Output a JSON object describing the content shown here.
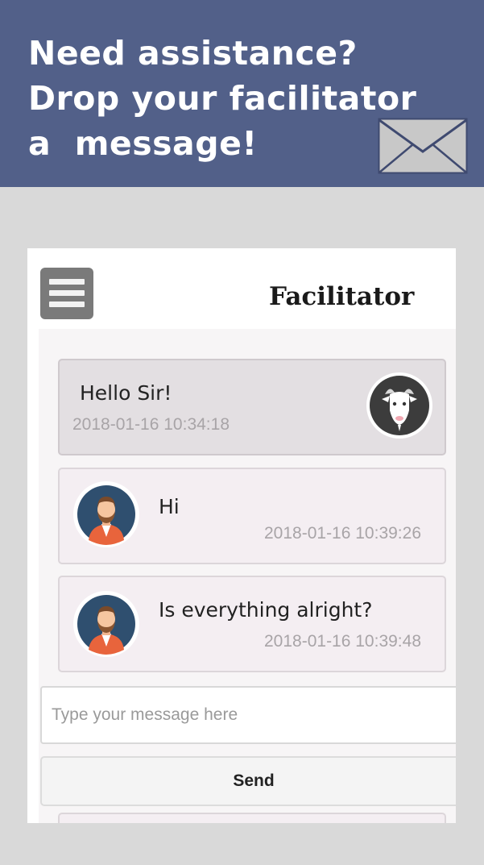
{
  "banner": {
    "line1": "Need assistance?",
    "line2": "Drop your facilitator",
    "line3": "a  message!",
    "background_color": "#526089",
    "icon": "envelope-icon"
  },
  "app": {
    "title": "Facilitator",
    "menu_icon": "hamburger-menu-icon"
  },
  "messages": [
    {
      "sender": "facilitator",
      "avatar": "goat-avatar",
      "text": "Hello Sir!",
      "time": "2018-01-16 10:34:18"
    },
    {
      "sender": "user",
      "avatar": "bearded-man-avatar",
      "text": "Hi",
      "time": "2018-01-16 10:39:26"
    },
    {
      "sender": "user",
      "avatar": "bearded-man-avatar",
      "text": "Is everything alright?",
      "time": "2018-01-16 10:39:48"
    }
  ],
  "composer": {
    "placeholder": "Type your message here",
    "send_label": "Send"
  }
}
